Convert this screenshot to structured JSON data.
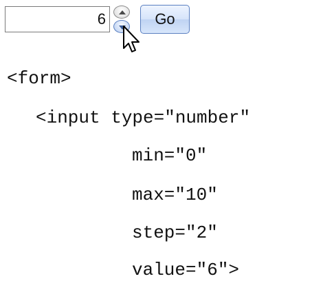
{
  "widget": {
    "number_input": {
      "value": "6"
    },
    "spinner": {
      "up_icon": "triangle-up-icon",
      "down_icon": "triangle-down-icon"
    },
    "go_button": {
      "label": "Go"
    },
    "cursor_icon": "arrow-pointer-icon"
  },
  "code": {
    "lines": [
      "<form>",
      "<input type=\"number\"",
      "min=\"0\"",
      "max=\"10\"",
      "step=\"2\"",
      "value=\"6\">"
    ]
  },
  "colors": {
    "button_border": "#5a7fc0",
    "button_fill": "#d6e4fa",
    "text": "#111111"
  }
}
